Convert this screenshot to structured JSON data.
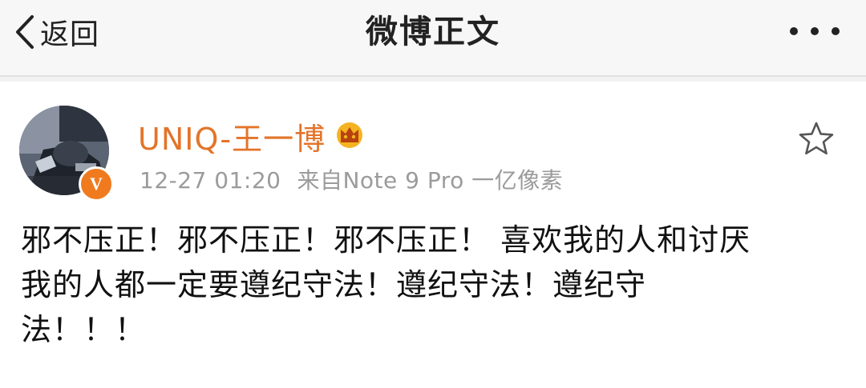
{
  "navbar": {
    "back_label": "返回",
    "title": "微博正文"
  },
  "post": {
    "username": "UNIQ-王一博",
    "time": "12-27 01:20",
    "source": "来自Note 9 Pro 一亿像素",
    "verified_mark": "V",
    "text_lines": [
      "邪不压正！邪不压正！邪不压正！ 喜欢我的人和讨厌",
      "我的人都一定要遵纪守法！遵纪守法！遵纪守",
      "法！！！"
    ]
  },
  "colors": {
    "username": "#e3742a",
    "verified_badge": "#f07a1e",
    "crown": "#f5b321",
    "meta_text": "#9b9b9b",
    "navbar_bg": "#f7f7f7"
  },
  "icons": {
    "back": "chevron-left-icon",
    "more": "more-dots-icon",
    "favorite": "star-outline-icon",
    "vip": "crown-icon",
    "verified": "verified-badge-icon"
  }
}
